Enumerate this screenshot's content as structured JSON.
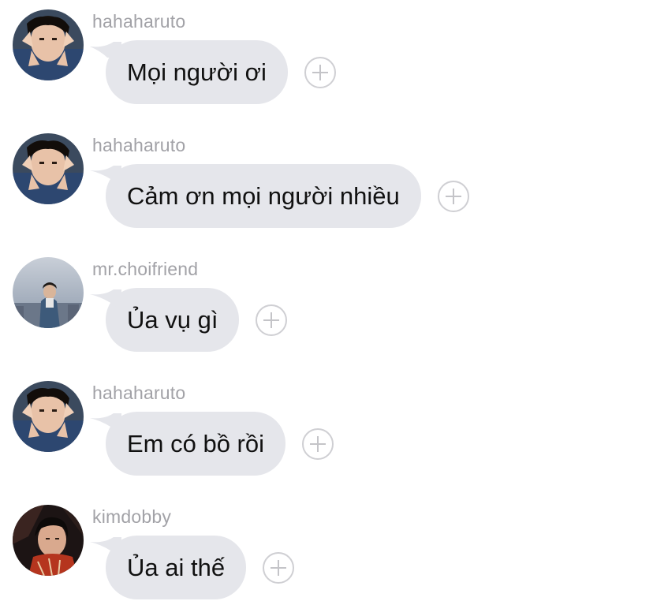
{
  "messages": [
    {
      "username": "hahaharuto",
      "text": "Mọi người ơi",
      "avatar": "avatar-haruto"
    },
    {
      "username": "hahaharuto",
      "text": "Cảm ơn mọi người nhiều",
      "avatar": "avatar-haruto"
    },
    {
      "username": "mr.choifriend",
      "text": "Ủa vụ gì",
      "avatar": "avatar-choifriend"
    },
    {
      "username": "hahaharuto",
      "text": "Em có bồ rồi",
      "avatar": "avatar-haruto"
    },
    {
      "username": "kimdobby",
      "text": "Ủa ai thế",
      "avatar": "avatar-kimdobby"
    }
  ],
  "icons": {
    "react": "plus-circle-icon"
  },
  "colors": {
    "bubble": "#e5e6eb",
    "username": "#a2a2a7",
    "plus_border": "#cfcfd3"
  }
}
